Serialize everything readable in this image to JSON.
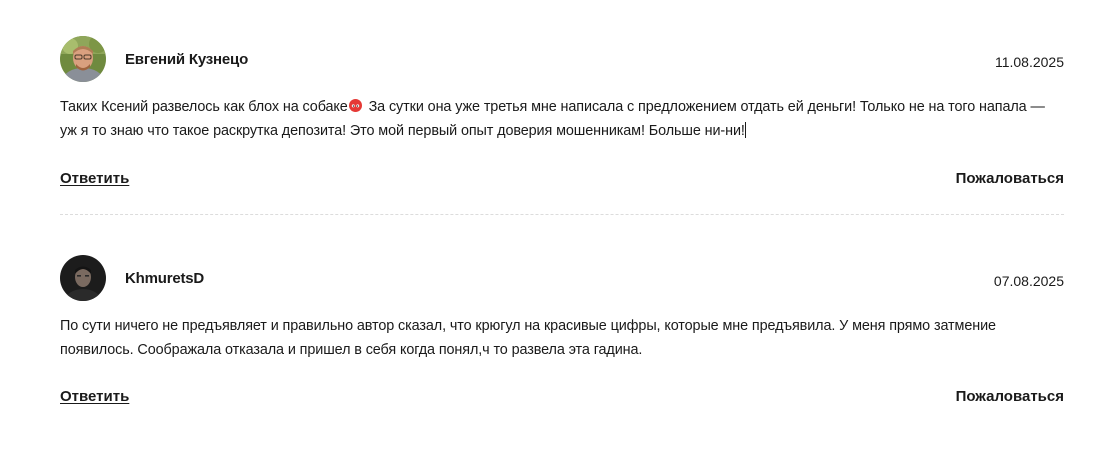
{
  "comments": [
    {
      "author": "Евгений Кузнецо",
      "date": "11.08.2025",
      "avatar_icon": "user-photo-avatar",
      "text_part1": "Таких Ксений развелось как блох на собаке",
      "emoji_icon": "angry-face-emoji-icon",
      "text_part2": " За сутки она уже третья мне написала с предложением отдать ей деньги! Только не на того напала — уж я то знаю что такое раскрутка депозита! Это мой первый опыт доверия мошенникам! Больше ни-ни!",
      "reply_label": "Ответить",
      "report_label": "Пожаловаться"
    },
    {
      "author": "KhmuretsD",
      "date": "07.08.2025",
      "avatar_icon": "user-photo-avatar",
      "text": "По сути ничего не предъявляет и правильно автор сказал, что крюгул на красивые цифры, которые мне предъявила. У меня прямо затмение появилось. Соображала отказала и пришел в себя когда понял,ч то развела эта гадина.",
      "reply_label": "Ответить",
      "report_label": "Пожаловаться"
    }
  ],
  "colors": {
    "text": "#1a1a1a",
    "divider": "#dcdcdc",
    "emoji": "#e53935"
  }
}
